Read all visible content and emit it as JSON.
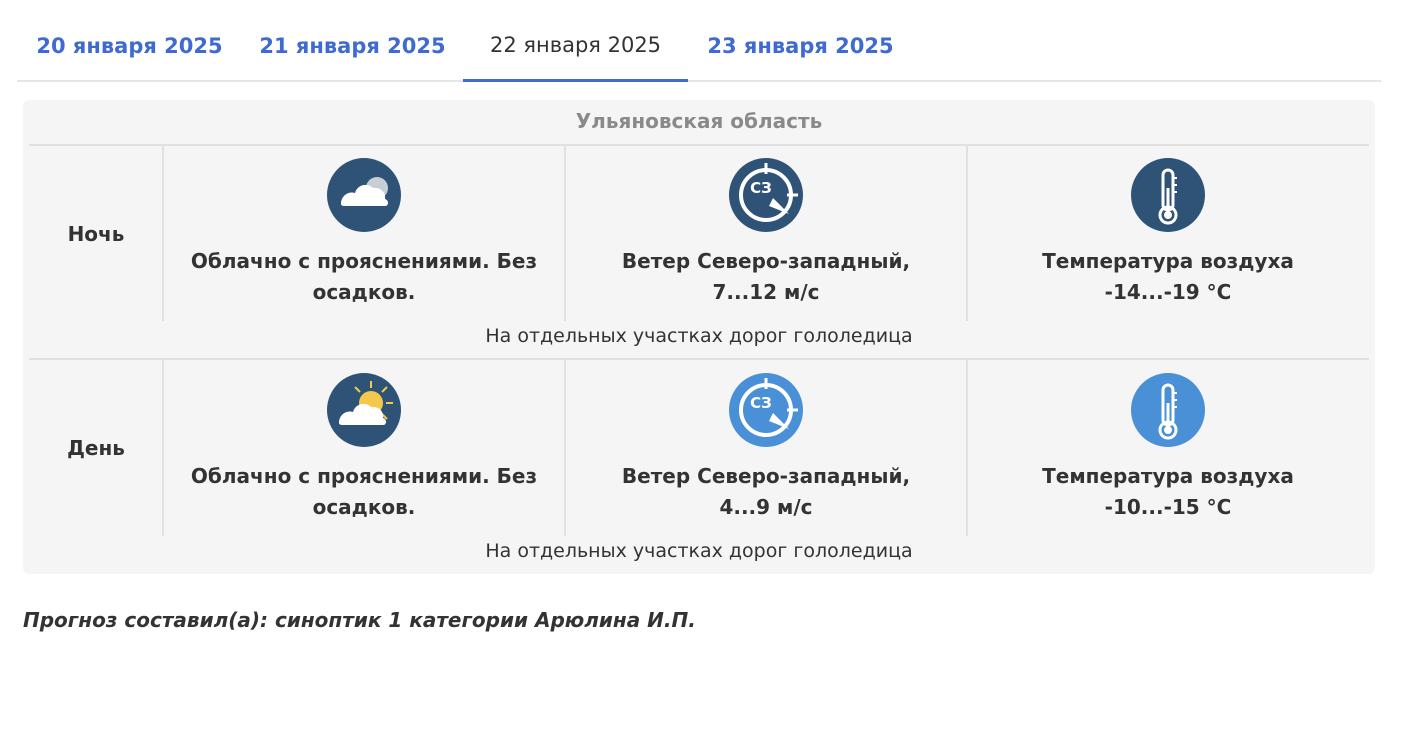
{
  "tabs": [
    {
      "label": "20 января 2025",
      "active": false
    },
    {
      "label": "21 января 2025",
      "active": false
    },
    {
      "label": "22 января 2025",
      "active": true
    },
    {
      "label": "23 января 2025",
      "active": false
    }
  ],
  "region": "Ульяновская область",
  "rows": [
    {
      "period": "Ночь",
      "sky": "Облачно с прояснениями. Без\nосадков.",
      "wind_badge": "СЗ",
      "wind": "Ветер Северо-западный,\n7...12 м/с",
      "temp": "Температура воздуха\n-14...-19 °C",
      "note": "На отдельных участках дорог гололедица",
      "icon_color": "#2f5377"
    },
    {
      "period": "День",
      "sky": "Облачно с прояснениями. Без\nосадков.",
      "wind_badge": "СЗ",
      "wind": "Ветер Северо-западный,\n4...9 м/с",
      "temp": "Температура воздуха\n-10...-15 °C",
      "note": "На отдельных участках дорог гололедица",
      "icon_color": "#4a90d6"
    }
  ],
  "author": "Прогноз составил(а): синоптик 1 категории Арюлина И.П.",
  "colors": {
    "accent": "#3f6bd0",
    "night_icon": "#2f5377",
    "day_icon": "#4a90d6"
  }
}
